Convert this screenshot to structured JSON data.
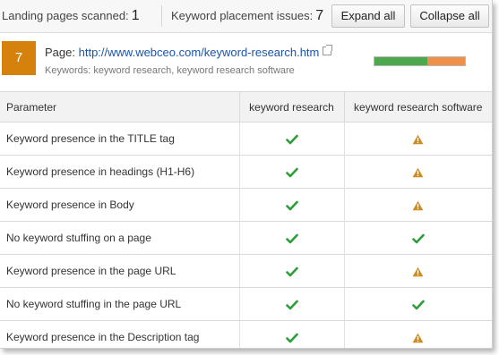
{
  "toolbar": {
    "landing_label": "Landing pages scanned:",
    "landing_count": "1",
    "issues_label": "Keyword placement issues:",
    "issues_count": "7",
    "expand_label": "Expand all",
    "collapse_label": "Collapse all"
  },
  "page": {
    "badge": "7",
    "page_label": "Page:",
    "url": "http://www.webceo.com/keyword-research.htm",
    "keywords_label": "Keywords:",
    "keywords": "keyword research, keyword research software",
    "progress": {
      "good_fraction": 0.58,
      "warn_fraction": 0.42
    }
  },
  "table": {
    "headers": [
      "Parameter",
      "keyword research",
      "keyword research software"
    ],
    "rows": [
      {
        "param": "Keyword presence in the TITLE tag",
        "kw1": "check",
        "kw2": "warning"
      },
      {
        "param": "Keyword presence in headings (H1-H6)",
        "kw1": "check",
        "kw2": "warning"
      },
      {
        "param": "Keyword presence in Body",
        "kw1": "check",
        "kw2": "warning"
      },
      {
        "param": "No keyword stuffing on a page",
        "kw1": "check",
        "kw2": "check"
      },
      {
        "param": "Keyword presence in the page URL",
        "kw1": "check",
        "kw2": "warning"
      },
      {
        "param": "No keyword stuffing in the page URL",
        "kw1": "check",
        "kw2": "check"
      },
      {
        "param": "Keyword presence in the Description tag",
        "kw1": "check",
        "kw2": "warning"
      }
    ]
  },
  "colors": {
    "badge": "#d4820c",
    "check": "#2e9e3a",
    "warning": "#d18b1a",
    "link": "#1a55a8",
    "progress_good": "#4da84d",
    "progress_warn": "#ef8f4a"
  }
}
